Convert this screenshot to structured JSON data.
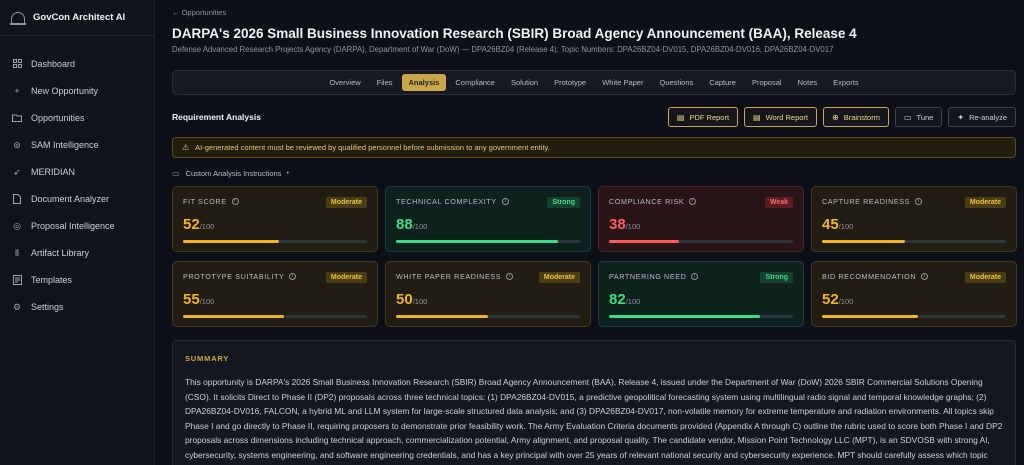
{
  "app": {
    "name": "GovCon Architect AI"
  },
  "sidebar": {
    "items": [
      {
        "label": "Dashboard",
        "icon": "grid-icon"
      },
      {
        "label": "New Opportunity",
        "icon": "plus-icon"
      },
      {
        "label": "Opportunities",
        "icon": "folder-icon"
      },
      {
        "label": "SAM Intelligence",
        "icon": "radar-icon"
      },
      {
        "label": "MERIDIAN",
        "icon": "send-icon"
      },
      {
        "label": "Document Analyzer",
        "icon": "document-icon"
      },
      {
        "label": "Proposal Intelligence",
        "icon": "target-icon"
      },
      {
        "label": "Artifact Library",
        "icon": "library-icon"
      },
      {
        "label": "Templates",
        "icon": "template-icon"
      },
      {
        "label": "Settings",
        "icon": "gear-icon"
      }
    ]
  },
  "header": {
    "breadcrumb": "Opportunities",
    "title": "DARPA's 2026 Small Business Innovation Research (SBIR) Broad Agency Announcement (BAA), Release 4",
    "subtitle": "Defense Advanced Research Projects Agency (DARPA), Department of War (DoW) — DPA26BZ04 (Release 4); Topic Numbers: DPA26BZ04-DV015, DPA26BZ04-DV016, DPA26BZ04-DV017"
  },
  "tabs": [
    "Overview",
    "Files",
    "Analysis",
    "Compliance",
    "Solution",
    "Prototype",
    "White Paper",
    "Questions",
    "Capture",
    "Proposal",
    "Notes",
    "Exports"
  ],
  "active_tab": "Analysis",
  "analysis": {
    "section_title": "Requirement Analysis",
    "buttons": {
      "pdf": "PDF Report",
      "word": "Word Report",
      "brainstorm": "Brainstorm",
      "tune": "Tune",
      "reanalyze": "Re-analyze"
    },
    "warning": "AI-generated content must be reviewed by qualified personnel before submission to any government entity.",
    "custom_instructions": "Custom Analysis Instructions",
    "score_suffix": "/100",
    "cards": [
      {
        "label": "FIT SCORE",
        "score": "52",
        "badge": "Moderate",
        "level": 0.52
      },
      {
        "label": "TECHNICAL COMPLEXITY",
        "score": "88",
        "badge": "Strong",
        "level": 0.88
      },
      {
        "label": "COMPLIANCE RISK",
        "score": "38",
        "badge": "Weak",
        "level": 0.38
      },
      {
        "label": "CAPTURE READINESS",
        "score": "45",
        "badge": "Moderate",
        "level": 0.45
      },
      {
        "label": "PROTOTYPE SUITABILITY",
        "score": "55",
        "badge": "Moderate",
        "level": 0.55
      },
      {
        "label": "WHITE PAPER READINESS",
        "score": "50",
        "badge": "Moderate",
        "level": 0.5
      },
      {
        "label": "PARTNERING NEED",
        "score": "82",
        "badge": "Strong",
        "level": 0.82
      },
      {
        "label": "BID RECOMMENDATION",
        "score": "52",
        "badge": "Moderate",
        "level": 0.52
      }
    ],
    "summary": {
      "heading": "SUMMARY",
      "text": "This opportunity is DARPA's 2026 Small Business Innovation Research (SBIR) Broad Agency Announcement (BAA), Release 4, issued under the Department of War (DoW) 2026 SBIR Commercial Solutions Opening (CSO). It solicits Direct to Phase II (DP2) proposals across three technical topics: (1) DPA26BZ04-DV015, a predictive geopolitical forecasting system using multilingual radio signal and temporal knowledge graphs; (2) DPA26BZ04-DV016, FALCON, a hybrid ML and LLM system for large-scale structured data analysis; and (3) DPA26BZ04-DV017, non-volatile memory for extreme temperature and radiation environments. All topics skip Phase I and go directly to Phase II, requiring proposers to demonstrate prior feasibility work. The Army Evaluation Criteria documents provided (Appendix A through C) outline the rubric used to score both Phase I and DP2 proposals across dimensions including technical approach, commercialization potential, Army alignment, and proposal quality. The candidate vendor, Mission Point Technology LLC (MPT), is an SDVOSB with strong AI, cybersecurity, systems engineering, and software engineering credentials, and has a key principal with over 25 years of relevant national security and cybersecurity experience. MPT should carefully assess which topic best aligns with its demonstrated capabilities before submitting."
    }
  },
  "colors": {
    "accent": "#c9a64a",
    "moderate": "#f0b429",
    "strong": "#3ddc84",
    "weak": "#ff5c5c"
  }
}
